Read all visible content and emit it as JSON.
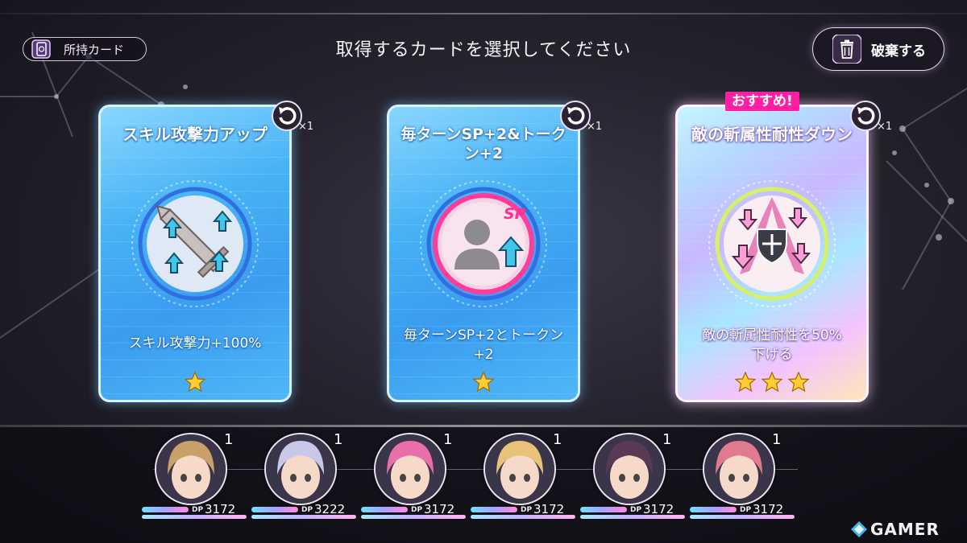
{
  "header": {
    "owned_cards_label": "所持カード",
    "title": "取得するカードを選択してください",
    "discard_label": "破棄する"
  },
  "cards": [
    {
      "title": "スキル攻撃力アップ",
      "description": "スキル攻撃力+100%",
      "rarity_stars": 1,
      "refresh_count": "×1",
      "icon": "sword-attack-up-icon",
      "style": "blue"
    },
    {
      "title": "毎ターンSP+2&トークン+2",
      "description": "毎ターンSP+2とトークン+2",
      "rarity_stars": 1,
      "refresh_count": "×1",
      "icon": "user-sp-up-icon",
      "badge_text": "SP",
      "style": "blue"
    },
    {
      "title": "敵の斬属性耐性ダウン",
      "description": "敵の斬属性耐性を50%下げる",
      "rarity_stars": 3,
      "refresh_count": "×1",
      "icon": "shield-resist-down-icon",
      "style": "rainbow",
      "tag": "おすすめ!"
    }
  ],
  "party": [
    {
      "level": "1",
      "dp_label": "DP",
      "dp": "3172",
      "hair": "#c9a06a"
    },
    {
      "level": "1",
      "dp_label": "DP",
      "dp": "3222",
      "hair": "#c9c8e8"
    },
    {
      "level": "1",
      "dp_label": "DP",
      "dp": "3172",
      "hair": "#e86fa8"
    },
    {
      "level": "1",
      "dp_label": "DP",
      "dp": "3172",
      "hair": "#e8c27a"
    },
    {
      "level": "1",
      "dp_label": "DP",
      "dp": "3172",
      "hair": "#5a3a52"
    },
    {
      "level": "1",
      "dp_label": "DP",
      "dp": "3172",
      "hair": "#e07a8e"
    }
  ],
  "watermark": "GAMER",
  "colors": {
    "accent_pink": "#ff1fa5",
    "card_blue": "#47b3f5",
    "star_gold": "#ffcc33"
  }
}
